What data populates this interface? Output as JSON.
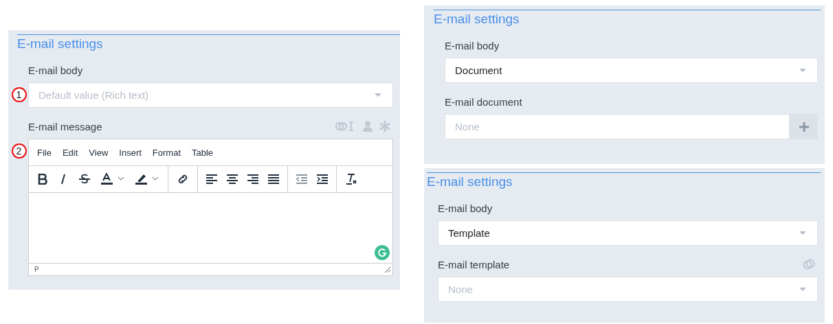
{
  "panels": [
    {
      "title": "E-mail settings",
      "fields": [
        {
          "kind": "select",
          "label": "E-mail body",
          "callout": "1",
          "placeholder": "Default value (Rich text)"
        },
        {
          "kind": "editor",
          "label": "E-mail message",
          "callout": "2",
          "label_icons": [
            {
              "kind": "link-text"
            },
            {
              "kind": "person"
            },
            {
              "kind": "asterisk"
            }
          ],
          "menu": [
            "File",
            "Edit",
            "View",
            "Insert",
            "Format",
            "Table"
          ],
          "toolbar": [
            [
              {
                "kind": "bold"
              },
              {
                "kind": "italic"
              },
              {
                "kind": "strike"
              },
              {
                "kind": "text-color"
              },
              {
                "kind": "highlight"
              }
            ],
            [
              {
                "kind": "link"
              }
            ],
            [
              {
                "kind": "align-left"
              },
              {
                "kind": "align-center"
              },
              {
                "kind": "align-right"
              },
              {
                "kind": "justify"
              }
            ],
            [
              {
                "kind": "outdent"
              },
              {
                "kind": "indent"
              }
            ],
            [
              {
                "kind": "clear-format"
              }
            ]
          ],
          "status": "P"
        }
      ]
    },
    {
      "title": "E-mail settings",
      "fields": [
        {
          "kind": "select",
          "label": "E-mail body",
          "value": "Document"
        },
        {
          "kind": "lookup",
          "label": "E-mail document",
          "placeholder": "None"
        }
      ]
    },
    {
      "title": "E-mail settings",
      "fields": [
        {
          "kind": "select",
          "label": "E-mail body",
          "value": "Template"
        },
        {
          "kind": "select",
          "label": "E-mail template",
          "label_icons": [
            {
              "kind": "link"
            }
          ],
          "placeholder": "None"
        }
      ]
    }
  ]
}
